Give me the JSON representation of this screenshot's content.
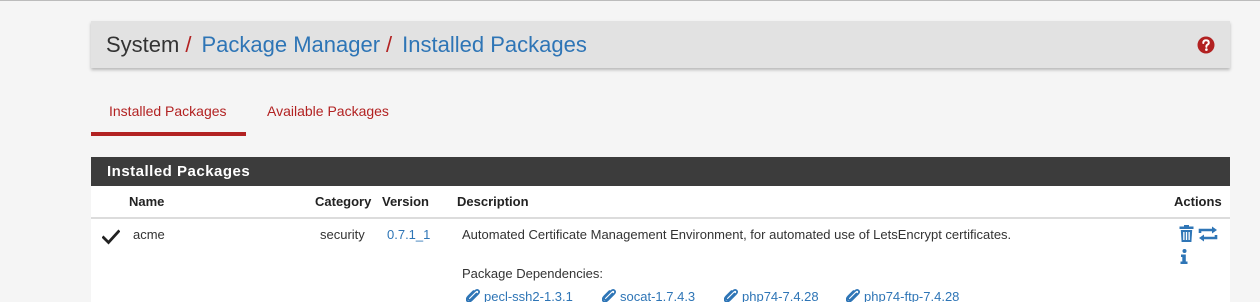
{
  "breadcrumb": {
    "system": "System",
    "separator": "/",
    "package_manager": "Package Manager",
    "installed_packages": "Installed Packages"
  },
  "tabs": [
    {
      "label": "Installed Packages",
      "active": true
    },
    {
      "label": "Available Packages",
      "active": false
    }
  ],
  "panel": {
    "title": "Installed Packages",
    "columns": {
      "name": "Name",
      "category": "Category",
      "version": "Version",
      "description": "Description",
      "actions": "Actions"
    },
    "rows": [
      {
        "status_icon": "check-icon",
        "name": "acme",
        "category": "security",
        "version": "0.7.1_1",
        "description": "Automated Certificate Management Environment, for automated use of LetsEncrypt certificates.",
        "dependencies_label": "Package Dependencies:",
        "dependencies": [
          "pecl-ssh2-1.3.1",
          "socat-1.7.4.3",
          "php74-7.4.28",
          "php74-ftp-7.4.28"
        ],
        "actions": [
          "trash-icon",
          "reinstall-icon",
          "info-icon"
        ]
      }
    ]
  },
  "colors": {
    "accent_red": "#b22222",
    "link_blue": "#2e75b6",
    "panel_heading": "#3c3c3c",
    "background": "#f5f5f5"
  }
}
